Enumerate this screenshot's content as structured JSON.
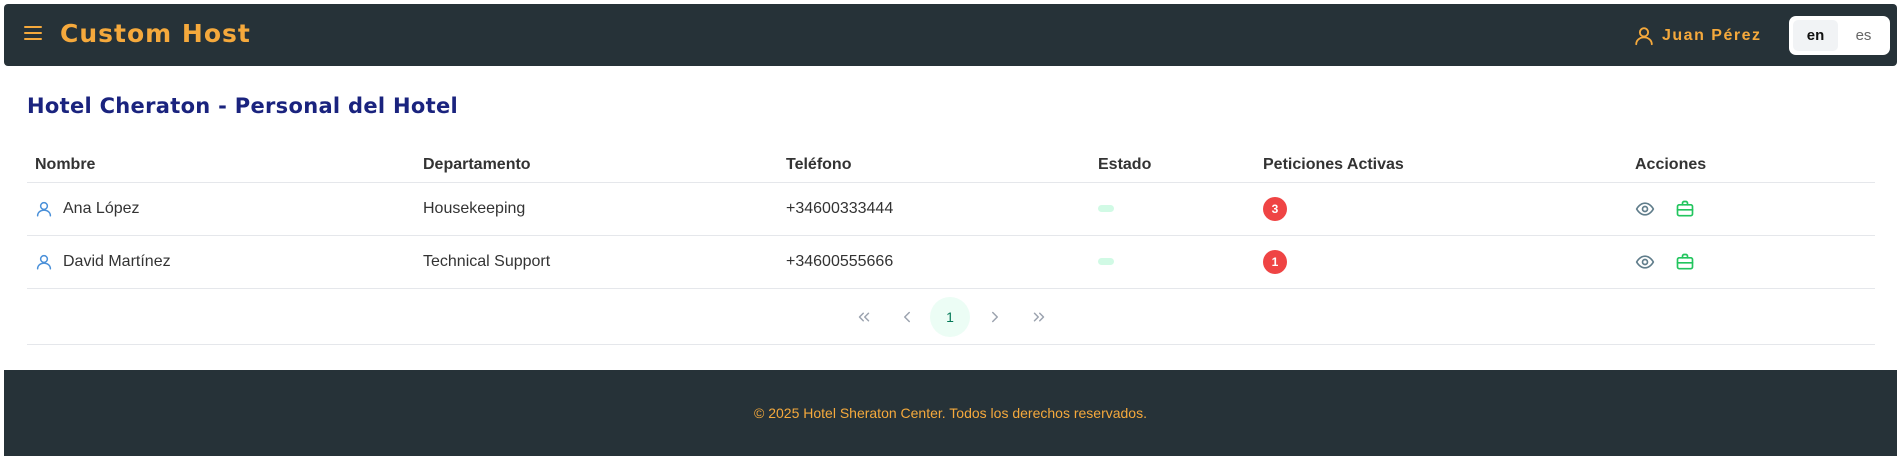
{
  "app": {
    "brand": "Custom Host"
  },
  "header": {
    "user_name": "Juan Pérez",
    "languages": [
      {
        "code": "en",
        "active": true
      },
      {
        "code": "es",
        "active": false
      }
    ]
  },
  "page": {
    "title": "Hotel Cheraton - Personal del Hotel"
  },
  "table": {
    "columns": [
      "Nombre",
      "Departamento",
      "Teléfono",
      "Estado",
      "Peticiones Activas",
      "Acciones"
    ],
    "rows": [
      {
        "name": "Ana López",
        "department": "Housekeeping",
        "phone": "+34600333444",
        "status_color": "#d1fae5",
        "active_requests": "3"
      },
      {
        "name": "David Martínez",
        "department": "Technical Support",
        "phone": "+34600555666",
        "status_color": "#d1fae5",
        "active_requests": "1"
      }
    ]
  },
  "pagination": {
    "current_page": "1"
  },
  "footer": {
    "text": "© 2025 Hotel Sheraton Center. Todos los derechos reservados."
  },
  "colors": {
    "header_bg": "#263238",
    "accent": "#f5a93c",
    "title": "#1a237e",
    "badge": "#ef4444",
    "view_icon": "#607d8b",
    "briefcase_icon": "#22c55e",
    "user_icon": "#4a90d9"
  },
  "icons": {
    "menu": "menu-icon",
    "user": "user-icon",
    "row_user": "user-icon",
    "view": "eye-icon",
    "assign": "briefcase-icon",
    "first": "chevrons-left-icon",
    "prev": "chevron-left-icon",
    "next": "chevron-right-icon",
    "last": "chevrons-right-icon"
  }
}
